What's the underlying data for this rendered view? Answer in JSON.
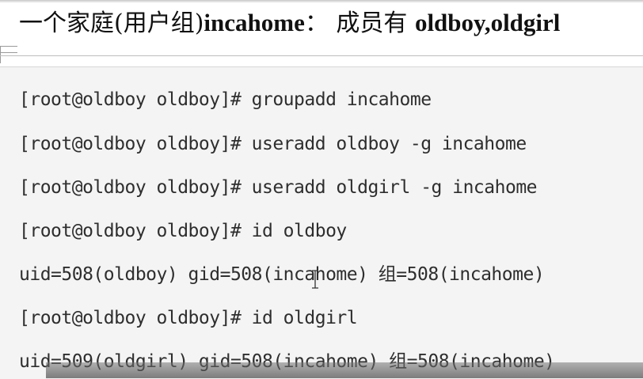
{
  "heading": {
    "prefix": "一个家庭(用户组)",
    "group_name": "incahome",
    "suffix": "： 成员有 ",
    "members": "oldboy,oldgirl"
  },
  "terminal": {
    "lines": [
      "[root@oldboy oldboy]# groupadd incahome",
      "[root@oldboy oldboy]# useradd oldboy -g incahome",
      "[root@oldboy oldboy]# useradd oldgirl -g incahome",
      "[root@oldboy oldboy]# id oldboy",
      "uid=508(oldboy) gid=508(incahome) 组=508(incahome)",
      "[root@oldboy oldboy]# id oldgirl",
      "uid=509(oldgirl) gid=508(incahome) 组=508(incahome)"
    ]
  },
  "video": {
    "progress_fraction": 0.0
  },
  "icons": {
    "cursor": "text-cursor-icon"
  },
  "colors": {
    "text": "#2e2e2e",
    "heading": "#111111",
    "code_background": "#f4f4f4"
  }
}
